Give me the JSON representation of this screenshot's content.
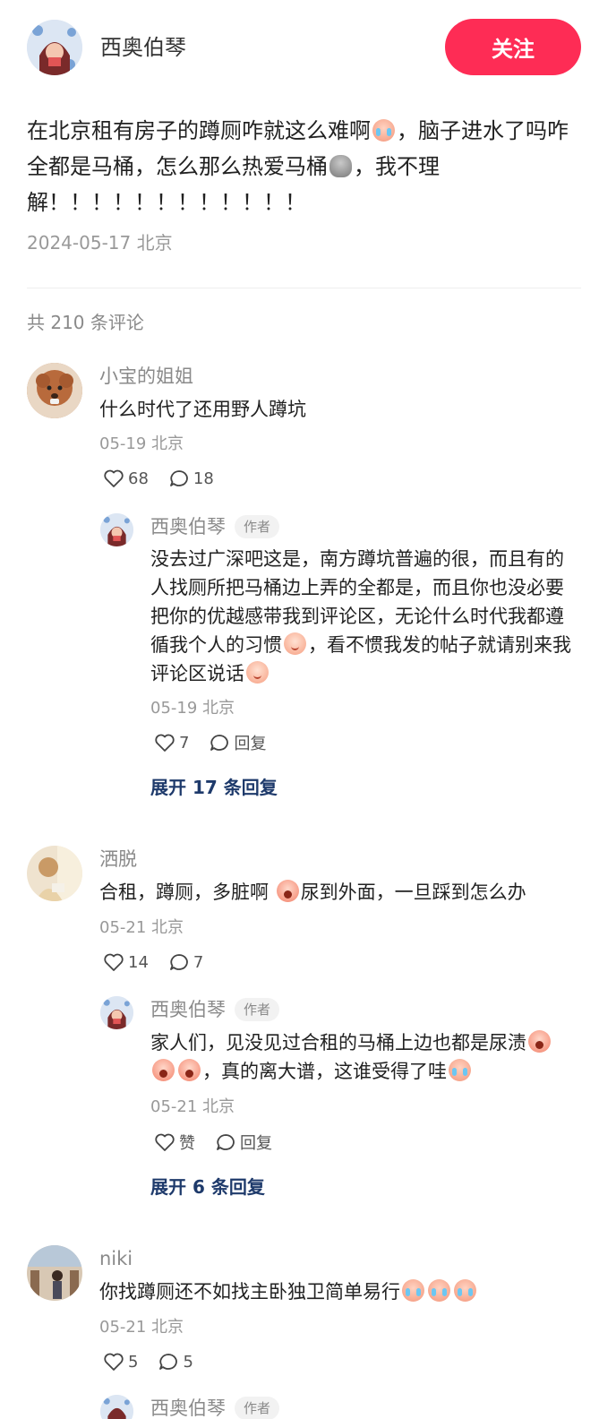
{
  "post": {
    "author": "西奥伯琴",
    "follow_label": "关注",
    "text_parts": {
      "p1": "在北京租有房子的蹲厕咋就这么难啊",
      "p2": "，脑子进水了吗咋全都是马桶，怎么那么热爱马桶",
      "p3": "，我不理解！！！！！！！！！！！！"
    },
    "meta": "2024-05-17 北京",
    "comment_count": "共 210 条评论"
  },
  "comments": [
    {
      "name": "小宝的姐姐",
      "text": "什么时代了还用野人蹲坑",
      "date": "05-19 北京",
      "likes": "68",
      "replies": "18",
      "reply": {
        "name": "西奥伯琴",
        "tag": "作者",
        "text_parts": {
          "p1": "没去过广深吧这是，南方蹲坑普遍的很，而且有的人找厕所把马桶边上弄的全都是，而且你也没必要把你的优越感带我到评论区，无论什么时代我都遵循我个人的习惯",
          "p2": "，看不惯我发的帖子就请别来我评论区说话"
        },
        "date": "05-19 北京",
        "likes": "7",
        "reply_label": "回复"
      },
      "expand": "展开 17 条回复"
    },
    {
      "name": "洒脱",
      "text_parts": {
        "p1": "合租，蹲厕，多脏啊 ",
        "p2": "尿到外面，一旦踩到怎么办"
      },
      "date": "05-21 北京",
      "likes": "14",
      "replies": "7",
      "reply": {
        "name": "西奥伯琴",
        "tag": "作者",
        "text_parts": {
          "p1": "家人们，见没见过合租的马桶上边也都是尿渍",
          "p2": "，真的离大谱，这谁受得了哇"
        },
        "date": "05-21 北京",
        "like_label": "赞",
        "reply_label": "回复"
      },
      "expand": "展开 6 条回复"
    },
    {
      "name": "niki",
      "text": "你找蹲厕还不如找主卧独卫简单易行",
      "date": "05-21 北京",
      "likes": "5",
      "replies": "5"
    }
  ],
  "partial_reply": {
    "name": "西奥伯琴",
    "tag": "作者"
  },
  "colors": {
    "follow_button": "#fe2c55",
    "expand_link": "#1e3a6b",
    "meta_text": "#999999"
  },
  "icons": [
    "heart-icon",
    "comment-bubble-icon",
    "emoji-cry",
    "emoji-poop",
    "emoji-smile",
    "emoji-scream"
  ]
}
